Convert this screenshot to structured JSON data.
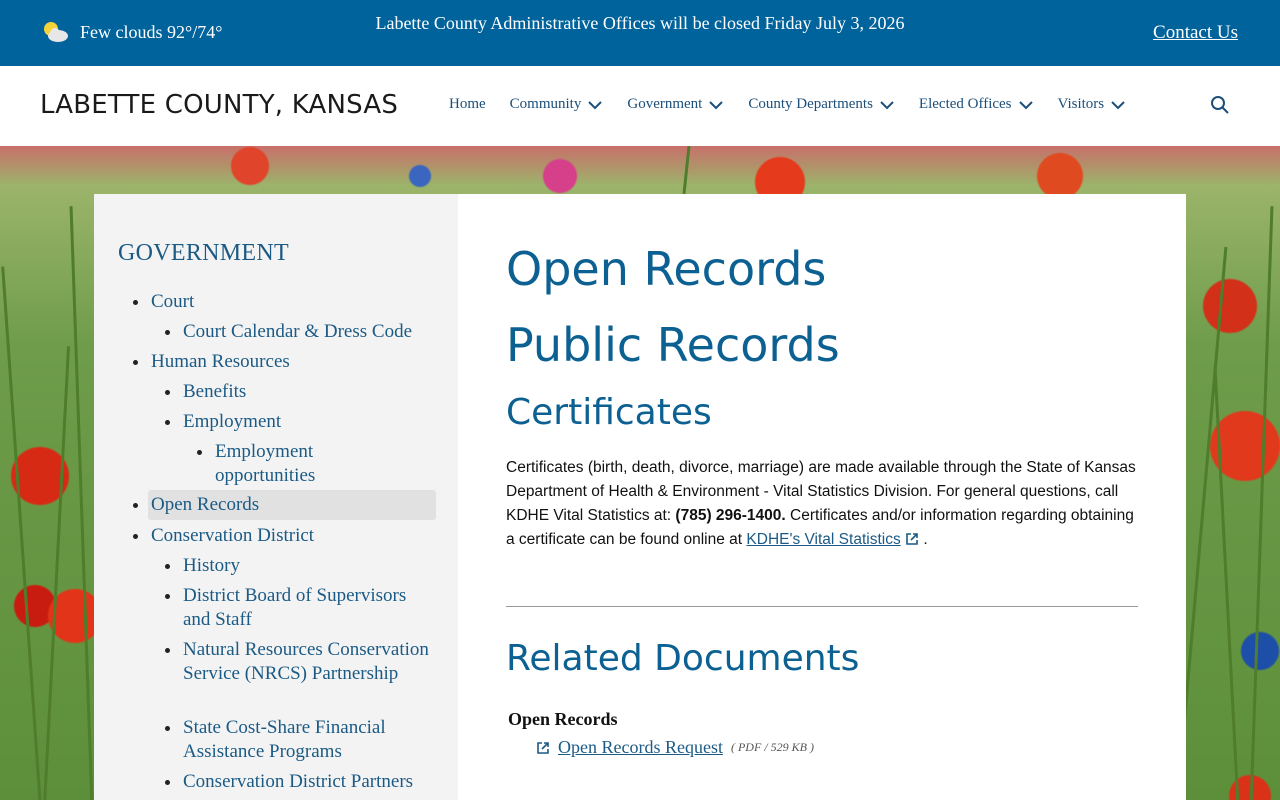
{
  "topbar": {
    "weather": "Few clouds 92°/74°",
    "alert": "Labette County Administrative Offices will be closed Friday July 3, 2026",
    "contact": "Contact Us"
  },
  "header": {
    "logo": "LABETTE COUNTY, KANSAS",
    "nav": [
      "Home",
      "Community",
      "Government",
      "County Departments",
      "Elected Offices",
      "Visitors"
    ]
  },
  "sidebar": {
    "title": "GOVERNMENT",
    "items": [
      {
        "label": "Court",
        "level": 0
      },
      {
        "label": "Court Calendar & Dress Code",
        "level": 1
      },
      {
        "label": "Human Resources",
        "level": 0
      },
      {
        "label": "Benefits",
        "level": 1
      },
      {
        "label": "Employment",
        "level": 1
      },
      {
        "label": "Employment opportunities",
        "level": 2
      },
      {
        "label": "Open Records",
        "level": 0,
        "active": true
      },
      {
        "label": "Conservation District",
        "level": 0
      },
      {
        "label": "History",
        "level": 1
      },
      {
        "label": "District Board of Supervisors and Staff",
        "level": 1
      },
      {
        "label": "Natural Resources Conservation Service (NRCS) Partnership",
        "level": 1
      },
      {
        "label": "State Cost-Share Financial Assistance Programs",
        "level": 1
      },
      {
        "label": "Conservation District Partners",
        "level": 1
      }
    ]
  },
  "content": {
    "h1": "Open Records",
    "h2": "Public Records",
    "h3": "Certificates",
    "para_1": "Certificates (birth, death, divorce, marriage) are made available through the State of Kansas Department of Health & Environment - Vital Statistics Division.  For general questions, call KDHE Vital Statistics at: ",
    "phone": "(785) 296-1400.",
    "para_2": "  Certificates and/or information regarding obtaining a certificate can be found online at ",
    "link": "KDHE's Vital Statistics",
    "para_end": ".",
    "h4": "Related Documents",
    "doc_category": "Open Records",
    "doc_link": "Open Records Request",
    "doc_meta": "( PDF / 529 KB )"
  },
  "colors": {
    "topbar": "#00639b",
    "heading": "#0c6192",
    "link": "#1b5a85"
  }
}
